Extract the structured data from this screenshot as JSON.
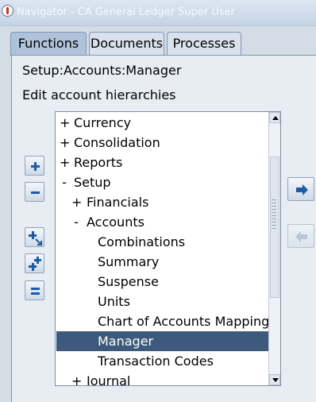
{
  "window": {
    "title": "Navigator - CA General Ledger Super User"
  },
  "tabs": [
    {
      "label": "Functions",
      "active": true
    },
    {
      "label": "Documents",
      "active": false
    },
    {
      "label": "Processes",
      "active": false
    }
  ],
  "current_function": "Setup:Accounts:Manager",
  "description": "Edit account hierarchies",
  "tree": {
    "items": [
      {
        "expander": "+",
        "label": "Currency"
      },
      {
        "expander": "+",
        "label": "Consolidation"
      },
      {
        "expander": "+",
        "label": "Reports"
      },
      {
        "expander": "-",
        "label": "Setup"
      },
      {
        "expander": "+",
        "label": "Financials"
      },
      {
        "expander": "-",
        "label": "Accounts"
      },
      {
        "expander": "",
        "label": "Combinations"
      },
      {
        "expander": "",
        "label": "Summary"
      },
      {
        "expander": "",
        "label": "Suspense"
      },
      {
        "expander": "",
        "label": "Units"
      },
      {
        "expander": "",
        "label": "Chart of Accounts Mapping"
      },
      {
        "expander": "",
        "label": "Manager",
        "selected": true
      },
      {
        "expander": "",
        "label": "Transaction Codes"
      },
      {
        "expander": "+",
        "label": "Journal"
      }
    ]
  },
  "toolbar": {
    "expand_icon": "plus-icon",
    "collapse_icon": "minus-icon",
    "expand_branch_icon": "expand-branch-icon",
    "expand_all_icon": "expand-all-icon",
    "collapse_all_icon": "collapse-all-icon"
  },
  "navigation": {
    "add_icon": "arrow-right-icon",
    "remove_icon": "arrow-left-icon"
  },
  "colors": {
    "selection": "#3d5a7c",
    "active_tab": "#aec3d9",
    "panel": "#e8edf3"
  }
}
